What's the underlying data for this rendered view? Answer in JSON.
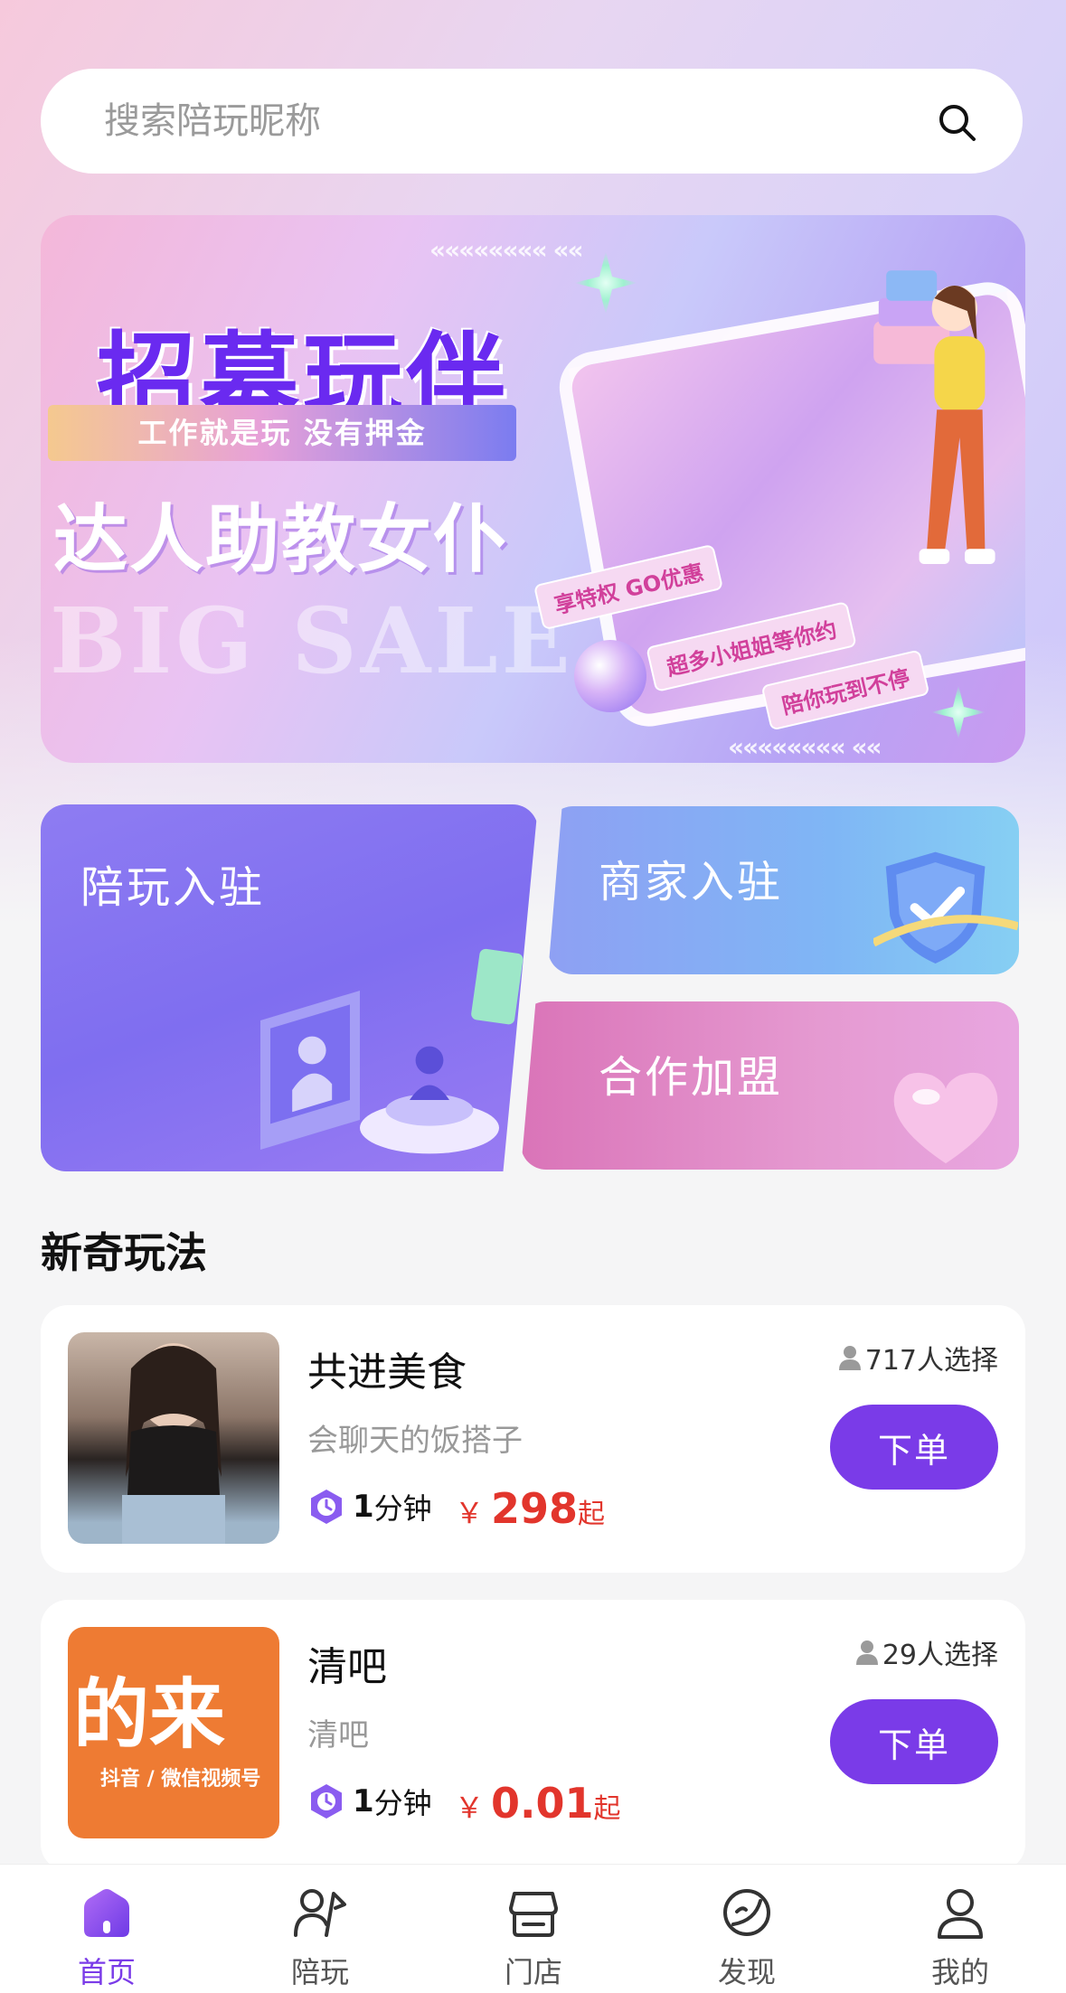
{
  "search": {
    "placeholder": "搜索陪玩昵称"
  },
  "banner": {
    "title": "招募玩伴",
    "tagline": "工作就是玩 没有押金",
    "subtitle": "达人助教女仆",
    "watermark": "BIG SALE",
    "pill_1": "享特权 GO优惠",
    "pill_2": "超多小姐姐等你约",
    "pill_3": "陪你玩到不停"
  },
  "entries": {
    "peiwan": "陪玩入驻",
    "shangjia": "商家入驻",
    "hezuo": "合作加盟"
  },
  "section": {
    "title": "新奇玩法"
  },
  "items": [
    {
      "name": "共进美食",
      "desc": "会聊天的饭搭子",
      "time_num": "1",
      "time_unit": "分钟",
      "yen": "￥",
      "price": "298",
      "price_suffix": "起",
      "chosen": "717人选择",
      "button": "下单"
    },
    {
      "name": "清吧",
      "desc": "清吧",
      "time_num": "1",
      "time_unit": "分钟",
      "yen": "￥",
      "price": "0.01",
      "price_suffix": "起",
      "chosen": "29人选择",
      "button": "下单",
      "thumb_text_big": "的来",
      "thumb_text_small": "抖音 / 微信视频号"
    }
  ],
  "tabbar": {
    "tabs": [
      {
        "label": "首页",
        "icon": "home-icon",
        "active": true
      },
      {
        "label": "陪玩",
        "icon": "companion-icon",
        "active": false
      },
      {
        "label": "门店",
        "icon": "store-icon",
        "active": false
      },
      {
        "label": "发现",
        "icon": "discover-icon",
        "active": false
      },
      {
        "label": "我的",
        "icon": "profile-icon",
        "active": false
      }
    ]
  },
  "colors": {
    "accent": "#7a3be8",
    "price": "#e2352c"
  }
}
